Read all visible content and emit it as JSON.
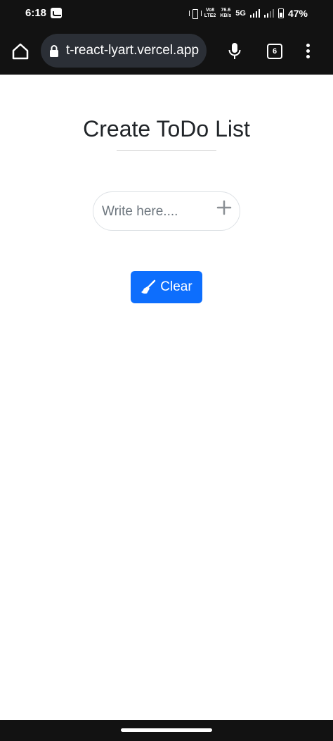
{
  "status_bar": {
    "time": "6:18",
    "volte_top": "Vo8",
    "volte_bottom": "LTE2",
    "speed_value": "76.6",
    "speed_unit": "KB/s",
    "network": "5G",
    "battery": "47%"
  },
  "browser": {
    "url": "t-react-lyart.vercel.app",
    "tab_count": "6"
  },
  "todo": {
    "title": "Create ToDo List",
    "input_value": "",
    "input_placeholder": "Write here....",
    "clear_label": "Clear"
  },
  "colors": {
    "accent": "#0d6efd",
    "chrome_background": "#121212",
    "url_bar": "#2b2f36"
  },
  "icons": {
    "home": "home-icon",
    "lock": "lock-icon",
    "mic": "mic-icon",
    "menu": "menu-icon",
    "add": "plus-icon",
    "clear": "broom-icon"
  }
}
